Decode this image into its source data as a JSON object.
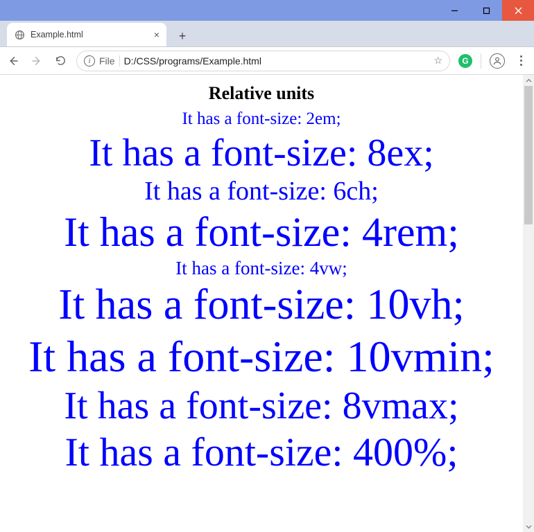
{
  "window": {
    "tab_title": "Example.html",
    "address_scheme": "File",
    "address_path": "D:/CSS/programs/Example.html"
  },
  "icons": {
    "globe": "globe",
    "tab_close": "×",
    "new_tab": "+",
    "minimize": "—",
    "maximize": "☐",
    "close": "✕",
    "info": "i",
    "star": "☆",
    "ext_badge_letter": "G"
  },
  "page": {
    "heading": "Relative units",
    "lines": {
      "em": "It has a font-size: 2em;",
      "ex": "It has a font-size: 8ex;",
      "ch": "It has a font-size: 6ch;",
      "rem": "It has a font-size: 4rem;",
      "vw": "It has a font-size: 4vw;",
      "vh": "It has a font-size: 10vh;",
      "vmin": "It has a font-size: 10vmin;",
      "vmax": "It has a font-size: 8vmax;",
      "pct": "It has a font-size: 400%;"
    }
  }
}
